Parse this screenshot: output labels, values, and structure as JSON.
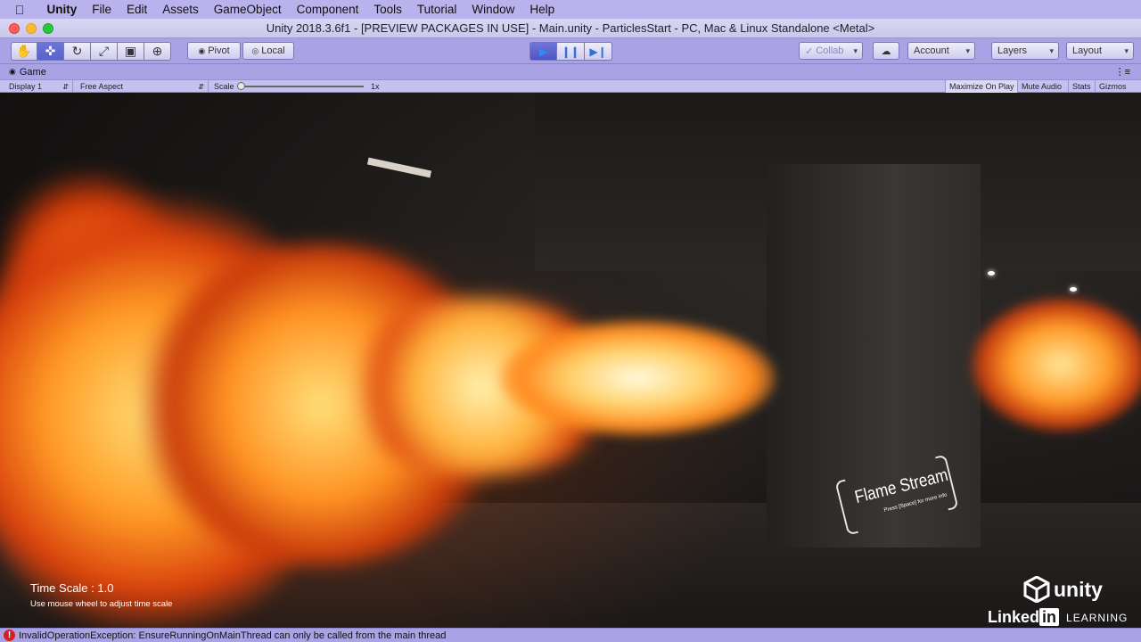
{
  "menubar": {
    "app": "Unity",
    "items": [
      "File",
      "Edit",
      "Assets",
      "GameObject",
      "Component",
      "Tools",
      "Tutorial",
      "Window",
      "Help"
    ]
  },
  "window": {
    "title": "Unity 2018.3.6f1 - [PREVIEW PACKAGES IN USE] - Main.unity - ParticlesStart - PC, Mac & Linux Standalone <Metal>"
  },
  "toolbar": {
    "tools": [
      {
        "name": "hand-tool",
        "icon": "hand-icon",
        "glyph": "✋"
      },
      {
        "name": "move-tool",
        "icon": "move-icon",
        "glyph": "✜",
        "active": true
      },
      {
        "name": "rotate-tool",
        "icon": "rotate-icon",
        "glyph": "↻"
      },
      {
        "name": "scale-tool",
        "icon": "scale-icon",
        "glyph": "⤢"
      },
      {
        "name": "rect-tool",
        "icon": "rect-icon",
        "glyph": "▣"
      },
      {
        "name": "transform-tool",
        "icon": "transform-icon",
        "glyph": "⊕"
      }
    ],
    "pivot_label": "Pivot",
    "local_label": "Local",
    "collab_label": "Collab",
    "account_label": "Account",
    "layers_label": "Layers",
    "layout_label": "Layout"
  },
  "game_panel": {
    "tab_label": "Game",
    "display_label": "Display 1",
    "aspect_label": "Free Aspect",
    "scale_label": "Scale",
    "scale_value": "1x",
    "maximize_label": "Maximize On Play",
    "mute_label": "Mute Audio",
    "stats_label": "Stats",
    "gizmos_label": "Gizmos"
  },
  "scene": {
    "time_scale": "Time Scale : 1.0",
    "time_hint": "Use mouse wheel to adjust time scale",
    "sign_title": "Flame Stream",
    "sign_subtitle": "Press [Space] for more info",
    "unity_brand": "unity",
    "linkedin_brand": "Linked",
    "linkedin_in": "in",
    "linkedin_learning": "LEARNING"
  },
  "status": {
    "message": "InvalidOperationException: EnsureRunningOnMainThread can only be called from the main thread"
  },
  "colors": {
    "chrome": "#a9a3e6",
    "active_button": "#5a61c8",
    "error": "#d42222",
    "flame": "#ff9324"
  }
}
